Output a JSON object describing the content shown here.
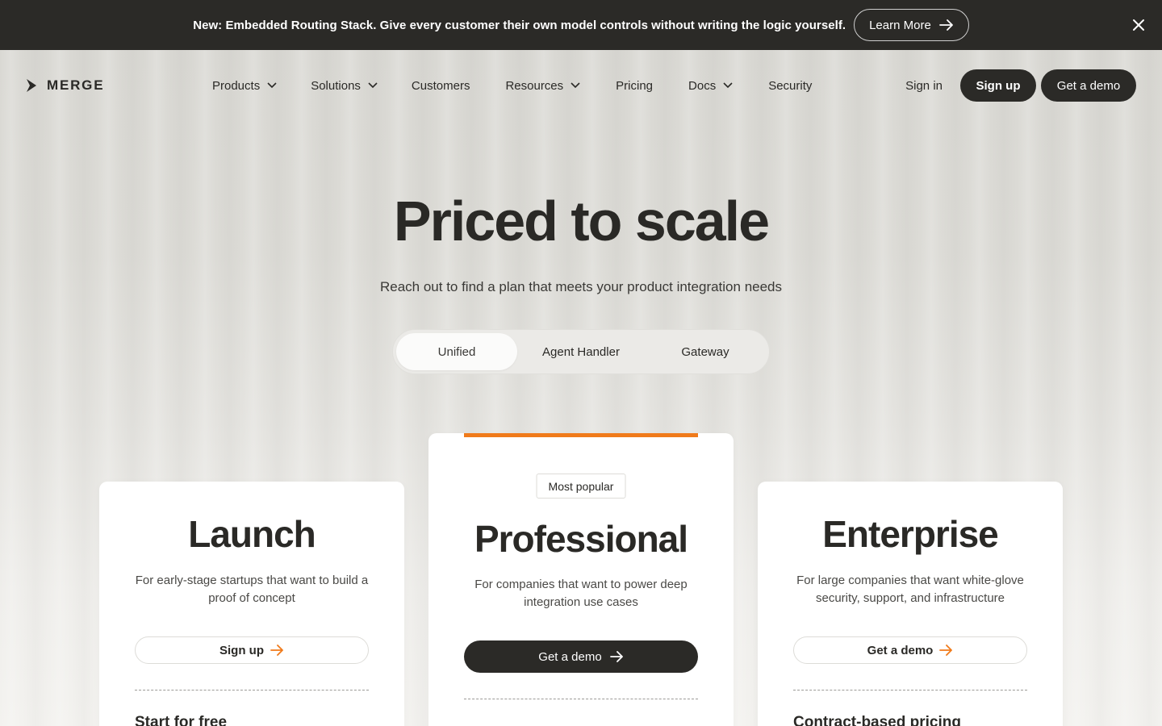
{
  "banner": {
    "text": "New: Embedded Routing Stack. Give every customer their own model controls without writing the logic yourself.",
    "button": "Learn More"
  },
  "nav": {
    "logo": "MERGE",
    "items": [
      {
        "label": "Products",
        "dropdown": true
      },
      {
        "label": "Solutions",
        "dropdown": true
      },
      {
        "label": "Customers",
        "dropdown": false
      },
      {
        "label": "Resources",
        "dropdown": true
      },
      {
        "label": "Pricing",
        "dropdown": false
      },
      {
        "label": "Docs",
        "dropdown": true
      },
      {
        "label": "Security",
        "dropdown": false
      }
    ],
    "sign_in": "Sign in",
    "sign_up": "Sign up",
    "demo": "Get a demo"
  },
  "hero": {
    "title": "Priced to scale",
    "subtitle": "Reach out to find a plan that meets your product integration needs"
  },
  "tabs": [
    {
      "label": "Unified",
      "active": true
    },
    {
      "label": "Agent Handler",
      "active": false
    },
    {
      "label": "Gateway",
      "active": false
    }
  ],
  "plans": {
    "launch": {
      "title": "Launch",
      "description": "For early-stage startups that want to build a proof of concept",
      "cta": "Sign up",
      "subheading": "Start for free"
    },
    "professional": {
      "badge": "Most popular",
      "title": "Professional",
      "description": "For companies that want to power deep integration use cases",
      "cta": "Get a demo"
    },
    "enterprise": {
      "title": "Enterprise",
      "description": "For large companies that want white-glove security, support, and infrastructure",
      "cta": "Get a demo",
      "subheading": "Contract-based pricing"
    }
  },
  "colors": {
    "accent": "#f07a1a",
    "dark": "#2b2a27"
  }
}
